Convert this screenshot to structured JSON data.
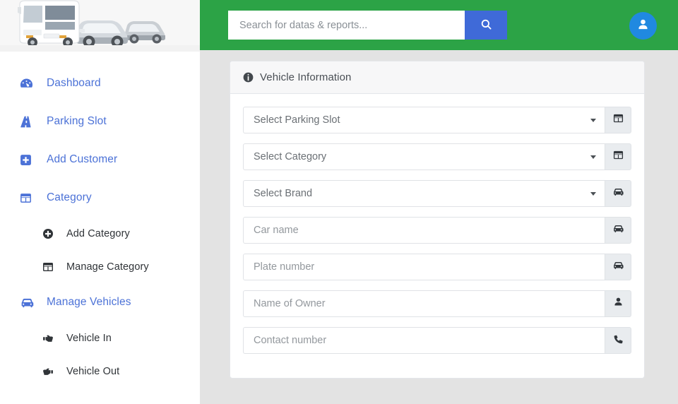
{
  "brand": {
    "logo_alt": "vehicle-fleet-photo"
  },
  "colors": {
    "header_green": "#2ca346",
    "accent_blue": "#4c72d7",
    "search_button_blue": "#3f6ad8",
    "avatar_blue": "#2089e0",
    "page_background": "#e3e3e3",
    "addon_gray": "#e9ecef"
  },
  "header": {
    "search": {
      "placeholder": "Search for datas & reports...",
      "value": "",
      "button_icon": "search-icon"
    },
    "avatar_icon": "user-icon"
  },
  "sidebar": {
    "items": [
      {
        "label": "Dashboard",
        "icon": "dashboard-gauge-icon",
        "level": "main",
        "active": false
      },
      {
        "label": "Parking Slot",
        "icon": "road-icon",
        "level": "main",
        "active": false
      },
      {
        "label": "Add Customer",
        "icon": "plus-square-icon",
        "level": "main",
        "active": false
      },
      {
        "label": "Category",
        "icon": "table-icon",
        "level": "main",
        "active": false
      },
      {
        "label": "Add Category",
        "icon": "plus-circle-icon",
        "level": "sub",
        "active": false
      },
      {
        "label": "Manage Category",
        "icon": "table-icon",
        "level": "sub",
        "active": false
      },
      {
        "label": "Manage Vehicles",
        "icon": "car-icon",
        "level": "main",
        "active": true
      },
      {
        "label": "Vehicle In",
        "icon": "hand-point-right-icon",
        "level": "sub",
        "active": false
      },
      {
        "label": "Vehicle Out",
        "icon": "hand-point-left-icon",
        "level": "sub",
        "active": false
      }
    ]
  },
  "main": {
    "card": {
      "title": "Vehicle Information",
      "title_icon": "info-circle-icon",
      "fields": [
        {
          "type": "select",
          "placeholder": "Select Parking Slot",
          "value": "Select Parking Slot",
          "addon_icon": "table-icon"
        },
        {
          "type": "select",
          "placeholder": "Select Category",
          "value": "Select Category",
          "addon_icon": "table-icon"
        },
        {
          "type": "select",
          "placeholder": "Select Brand",
          "value": "Select Brand",
          "addon_icon": "car-icon"
        },
        {
          "type": "text",
          "placeholder": "Car name",
          "value": "",
          "addon_icon": "car-icon"
        },
        {
          "type": "text",
          "placeholder": "Plate number",
          "value": "",
          "addon_icon": "car-icon"
        },
        {
          "type": "text",
          "placeholder": "Name of Owner",
          "value": "",
          "addon_icon": "user-icon"
        },
        {
          "type": "text",
          "placeholder": "Contact number",
          "value": "",
          "addon_icon": "phone-icon"
        }
      ]
    }
  }
}
